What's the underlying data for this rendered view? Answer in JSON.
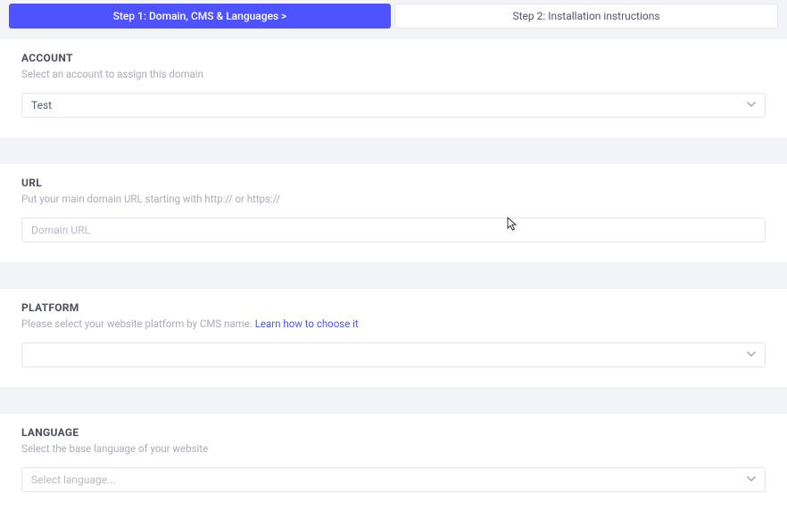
{
  "tabs": {
    "step1": "Step 1: Domain, CMS & Languages  >",
    "step2": "Step 2: Installation instructions"
  },
  "account": {
    "title": "ACCOUNT",
    "description": "Select an account to assign this domain",
    "selected": "Test"
  },
  "url": {
    "title": "URL",
    "description": "Put your main domain URL starting with http:// or https://",
    "placeholder": "Domain URL",
    "value": ""
  },
  "platform": {
    "title": "PLATFORM",
    "description_prefix": "Please select your website platform by CMS name.  ",
    "link_text": "Learn how to choose it",
    "selected": ""
  },
  "language": {
    "title": "LANGUAGE",
    "description": "Select the base language of your website",
    "selected": "Select language..."
  }
}
